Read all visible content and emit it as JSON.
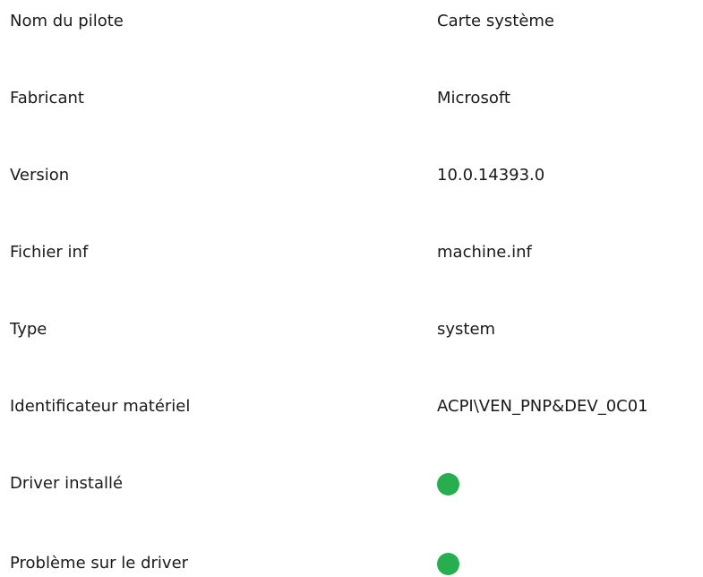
{
  "properties": [
    {
      "label": "Nom du pilote",
      "value": "Carte système"
    },
    {
      "label": "Fabricant",
      "value": "Microsoft"
    },
    {
      "label": "Version",
      "value": "10.0.14393.0"
    },
    {
      "label": "Fichier inf",
      "value": "machine.inf"
    },
    {
      "label": "Type",
      "value": "system"
    },
    {
      "label": "Identificateur matériel",
      "value": "ACPI\\VEN_PNP&DEV_0C01"
    },
    {
      "label": "Driver installé",
      "status": "ok"
    },
    {
      "label": "Problème sur le driver",
      "status": "ok"
    }
  ],
  "colors": {
    "status_ok": "#27ae4f",
    "text": "#1a1a1a"
  }
}
